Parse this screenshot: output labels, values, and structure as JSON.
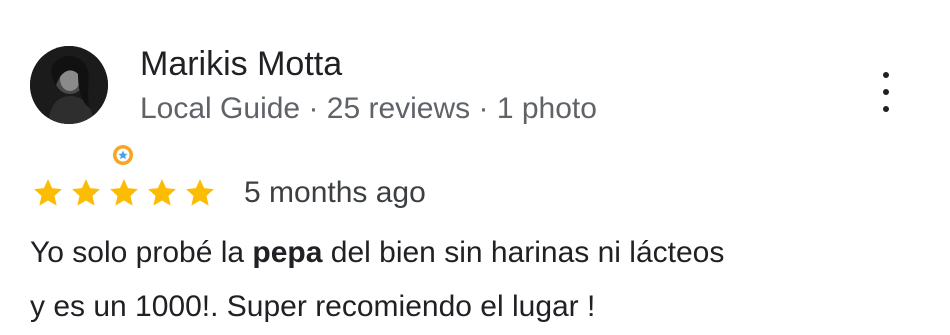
{
  "reviewer": {
    "name": "Marikis Motta",
    "meta": "Local Guide · 25 reviews · 1 photo"
  },
  "review": {
    "rating": 5,
    "rating_max": 5,
    "date": "5 months ago",
    "text_before": "Yo solo probé la ",
    "text_bold": "pepa",
    "text_after_line1": " del bien sin harinas ni lácteos",
    "text_line2": "y es un 1000!. Super recomiendo el lugar !"
  },
  "colors": {
    "star": "#fbbc04",
    "badge": "#f5a623",
    "badge_inner": "#ffffff",
    "meta_text": "#5f6368"
  },
  "icons": {
    "more": "more-vert-icon",
    "badge": "local-guide-badge-icon",
    "star": "star-icon"
  }
}
